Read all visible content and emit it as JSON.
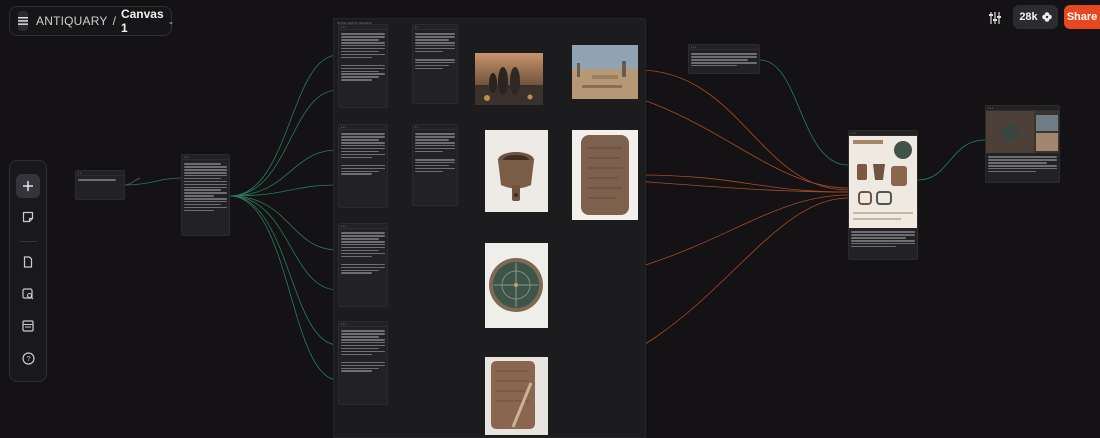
{
  "header": {
    "brand": "ANTIQUARY",
    "separator": "/",
    "canvas_name": "Canvas 1",
    "credits": "28k",
    "share_label": "Share"
  },
  "group": {
    "title": "NODE GROUP HEADING"
  },
  "left_toolbar": {
    "items": [
      "add-icon",
      "sticky-note-icon",
      "document-icon",
      "image-search-icon",
      "layout-icon",
      "help-icon"
    ]
  },
  "colors": {
    "accent": "#e8481f",
    "wire_green": "#2f8f6a",
    "wire_orange": "#b4522a",
    "background": "#141214"
  }
}
